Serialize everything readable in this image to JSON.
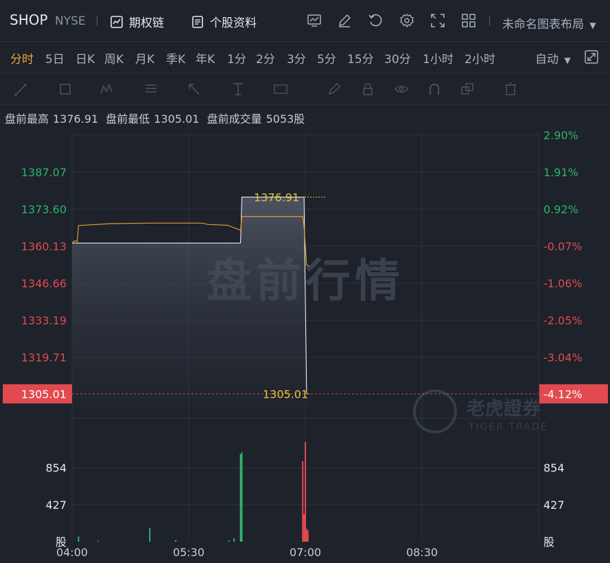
{
  "header": {
    "ticker": "SHOP",
    "exchange": "NYSE",
    "options_chain": "期权链",
    "stock_profile": "个股资料",
    "layout_name": "未命名图表布局"
  },
  "periods": [
    "分时",
    "5日",
    "日K",
    "周K",
    "月K",
    "季K",
    "年K",
    "1分",
    "2分",
    "3分",
    "5分",
    "15分",
    "30分",
    "1小时",
    "2小时"
  ],
  "active_period": "分时",
  "mode": "自动",
  "info": {
    "high_label": "盘前最高",
    "high_value": "1376.91",
    "low_label": "盘前最低",
    "low_value": "1305.01",
    "volume_label": "盘前成交量",
    "volume_value": "5053股"
  },
  "watermark": {
    "title": "盘前行情",
    "brand": "老虎證券",
    "brand_en": "TIGER TRADE"
  },
  "colors": {
    "background": "#1d222b",
    "price_line": "#ffffff",
    "avg_line": "#e39a32",
    "up": "#2fb36a",
    "down": "#e24a4f",
    "highlight": "#e8c33a"
  },
  "chart_data": {
    "type": "line",
    "title": "",
    "x_ticks": [
      "04:00",
      "05:30",
      "07:00",
      "08:30"
    ],
    "y_ticks_left": [
      "1387.07",
      "1373.60",
      "1360.13",
      "1346.66",
      "1333.19",
      "1319.71",
      "1305.01"
    ],
    "y_ticks_right": [
      "2.90%",
      "1.91%",
      "0.92%",
      "-0.07%",
      "-1.06%",
      "-2.05%",
      "-3.04%",
      "-4.12%"
    ],
    "ylim": [
      1300.34,
      1400.54
    ],
    "current_price": "1305.01",
    "current_pct": "-4.12%",
    "high_marker": "1376.91",
    "low_marker": "1305.01",
    "price_series": {
      "name": "",
      "x": [
        "04:00",
        "04:01",
        "05:06",
        "05:07",
        "06:10",
        "06:11",
        "06:58",
        "06:59",
        "07:00",
        "07:01",
        "07:03"
      ],
      "y": [
        1360.1,
        1360.1,
        1360.1,
        1360.1,
        1360.1,
        1376.91,
        1376.91,
        1376.91,
        1340.0,
        1305.01,
        1305.01
      ]
    },
    "avg_series": {
      "name": "",
      "x": [
        "04:00",
        "04:02",
        "04:04",
        "04:05",
        "04:30",
        "05:00",
        "05:40",
        "05:45",
        "06:00",
        "06:10",
        "06:11",
        "06:58",
        "06:59",
        "07:00",
        "07:01",
        "07:03"
      ],
      "y": [
        1360.1,
        1361.0,
        1360.6,
        1366.5,
        1367.2,
        1367.4,
        1367.4,
        1366.9,
        1366.6,
        1364.8,
        1369.8,
        1369.8,
        1366.2,
        1359.0,
        1352.0,
        1351.7
      ]
    },
    "volume": {
      "y_ticks": [
        "854",
        "427"
      ],
      "unit": "股",
      "bars": [
        {
          "x": "04:05",
          "v": 60,
          "dir": "up"
        },
        {
          "x": "04:20",
          "v": 10,
          "dir": "up"
        },
        {
          "x": "05:00",
          "v": 160,
          "dir": "up"
        },
        {
          "x": "05:20",
          "v": 20,
          "dir": "up"
        },
        {
          "x": "06:01",
          "v": 15,
          "dir": "up"
        },
        {
          "x": "06:05",
          "v": 40,
          "dir": "up"
        },
        {
          "x": "06:10",
          "v": 1010,
          "dir": "up"
        },
        {
          "x": "06:11",
          "v": 1030,
          "dir": "up"
        },
        {
          "x": "06:58",
          "v": 930,
          "dir": "down"
        },
        {
          "x": "06:59",
          "v": 320,
          "dir": "down"
        },
        {
          "x": "07:00",
          "v": 1150,
          "dir": "down"
        },
        {
          "x": "07:01",
          "v": 150,
          "dir": "down"
        },
        {
          "x": "07:02",
          "v": 130,
          "dir": "down"
        }
      ]
    }
  }
}
